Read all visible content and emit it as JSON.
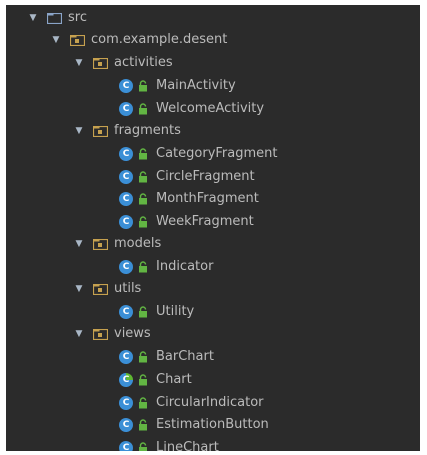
{
  "tree": {
    "src": "src",
    "package": "com.example.desent",
    "folders": {
      "activities": "activities",
      "fragments": "fragments",
      "models": "models",
      "utils": "utils",
      "views": "views"
    },
    "classes": {
      "main_activity": "MainActivity",
      "welcome_activity": "WelcomeActivity",
      "category_fragment": "CategoryFragment",
      "circle_fragment": "CircleFragment",
      "month_fragment": "MonthFragment",
      "week_fragment": "WeekFragment",
      "indicator": "Indicator",
      "utility": "Utility",
      "bar_chart": "BarChart",
      "chart": "Chart",
      "circular_indicator": "CircularIndicator",
      "estimation_button": "EstimationButton",
      "line_chart": "LineChart"
    },
    "class_glyph": "C",
    "colors": {
      "background": "#2b2b2b",
      "text": "#bbbbbb",
      "class_icon": "#3b8fd6",
      "lock_icon": "#62b543",
      "folder": "#c6a14f"
    },
    "icons": {
      "expand": "triangle-down-icon",
      "folder": "folder-icon",
      "package": "package-folder-icon",
      "class": "class-icon",
      "abstract_class": "abstract-class-icon",
      "visibility": "lock-icon"
    }
  }
}
